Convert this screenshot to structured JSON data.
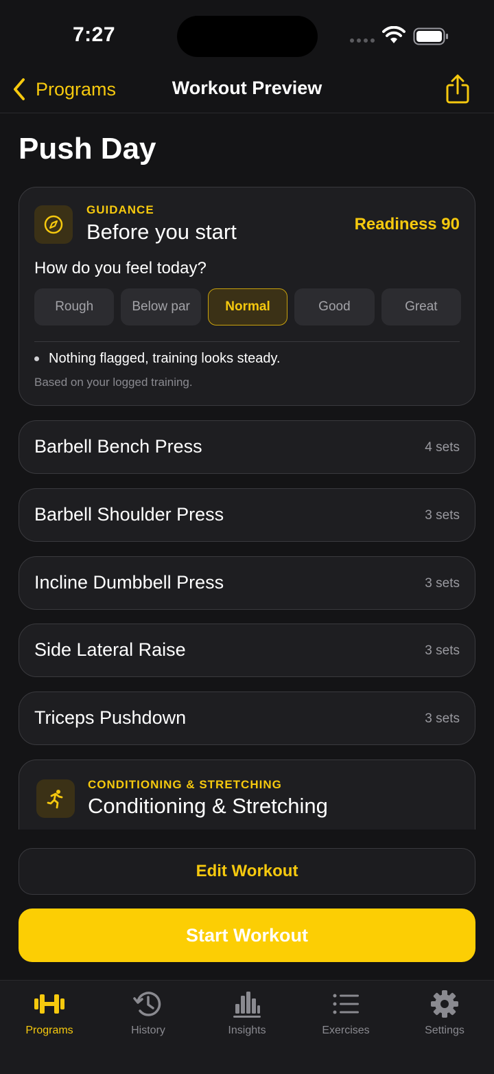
{
  "status_bar": {
    "time": "7:27"
  },
  "nav": {
    "back_label": "Programs",
    "title": "Workout Preview"
  },
  "page_title": "Push Day",
  "guidance": {
    "eyebrow": "GUIDANCE",
    "heading": "Before you start",
    "readiness": "Readiness 90",
    "question": "How do you feel today?",
    "options": [
      "Rough",
      "Below par",
      "Normal",
      "Good",
      "Great"
    ],
    "selected_option": "Normal",
    "note": "Nothing flagged, training looks steady.",
    "footnote": "Based on your logged training."
  },
  "exercises": [
    {
      "name": "Barbell Bench Press",
      "sets": "4 sets"
    },
    {
      "name": "Barbell Shoulder Press",
      "sets": "3 sets"
    },
    {
      "name": "Incline Dumbbell Press",
      "sets": "3 sets"
    },
    {
      "name": "Side Lateral Raise",
      "sets": "3 sets"
    },
    {
      "name": "Triceps Pushdown",
      "sets": "3 sets"
    }
  ],
  "conditioning": {
    "eyebrow": "CONDITIONING & STRETCHING",
    "heading": "Conditioning & Stretching"
  },
  "actions": {
    "edit_label": "Edit Workout",
    "start_label": "Start Workout"
  },
  "tabs": [
    {
      "label": "Programs",
      "icon": "dumbbell-icon",
      "active": true
    },
    {
      "label": "History",
      "icon": "history-clock-icon",
      "active": false
    },
    {
      "label": "Insights",
      "icon": "bar-chart-icon",
      "active": false
    },
    {
      "label": "Exercises",
      "icon": "list-icon",
      "active": false
    },
    {
      "label": "Settings",
      "icon": "gear-icon",
      "active": false
    }
  ],
  "colors": {
    "accent": "#f6c90e",
    "background": "#141416",
    "card": "#1e1e21",
    "start_button": "#fcce04"
  }
}
